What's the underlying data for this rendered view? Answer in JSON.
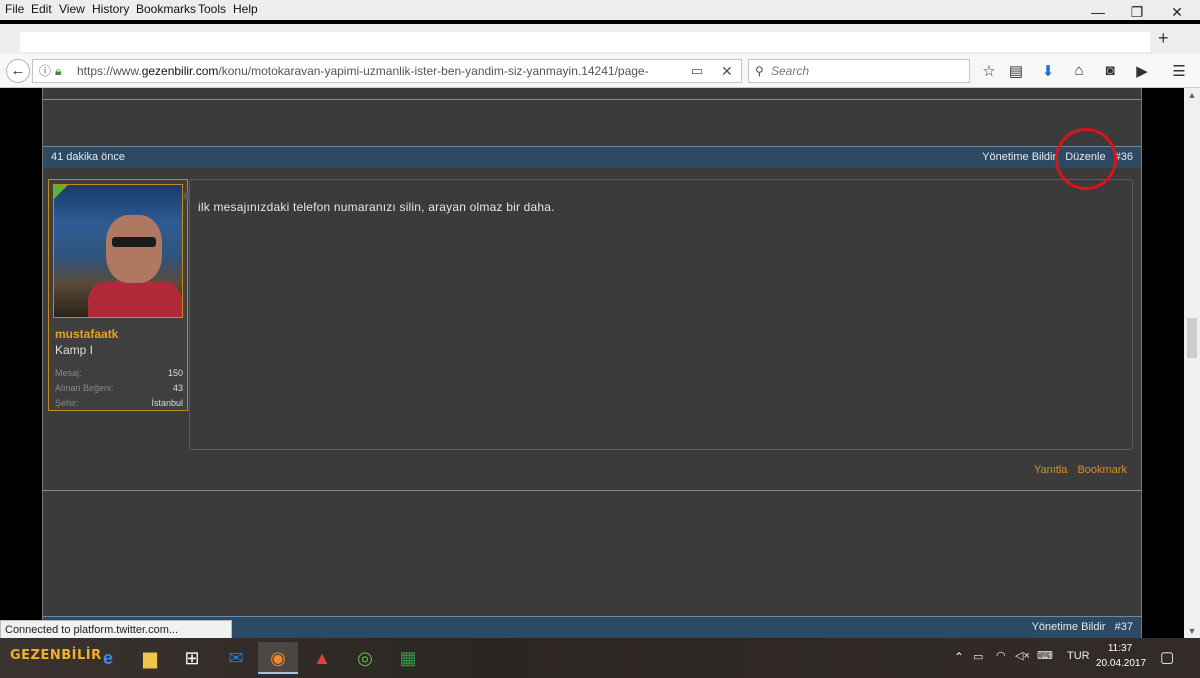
{
  "menubar": {
    "items": [
      "File",
      "Edit",
      "View",
      "History",
      "Bookmarks",
      "Tools",
      "Help"
    ],
    "window_controls": {
      "minimize": "—",
      "restore": "❐",
      "close": "✕"
    }
  },
  "tabstrip": {
    "new_tab": "+"
  },
  "navbar": {
    "back": "←",
    "url_prefix": "https://www.",
    "url_domain": "gezenbilir.com",
    "url_path": "/konu/motokaravan-yapimi-uzmanlik-ister-ben-yandim-siz-yanmayin.14241/page-",
    "search_placeholder": "Search"
  },
  "post_top_bar": {
    "time": "41 dakika önce",
    "report": "Yönetime Bildir",
    "edit": "Düzenle",
    "number": "#36"
  },
  "user": {
    "name": "mustafaatk",
    "title": "Kamp I",
    "stats": [
      {
        "label": "Mesaj:",
        "value": "150"
      },
      {
        "label": "Alınan Beğeni:",
        "value": "43"
      },
      {
        "label": "Şehir:",
        "value": "İstanbul"
      }
    ]
  },
  "message": {
    "text": "ilk mesajınızdaki telefon numaranızı silin, arayan olmaz bir daha."
  },
  "post_actions": {
    "reply": "Yanıtla",
    "bookmark": "Bookmark"
  },
  "next_post_bar": {
    "report": "Yönetime Bildir",
    "number": "#37"
  },
  "status": {
    "text": "Connected to platform.twitter.com..."
  },
  "taskbar": {
    "logo": "GEZENBİLİR",
    "language": "TUR",
    "time": "11:37",
    "date": "20.04.2017"
  },
  "colors": {
    "post_bar": "#2c4a63",
    "accent_orange": "#d8901e",
    "content_bg": "#3b3b3c",
    "highlight_circle": "#d8141c"
  }
}
